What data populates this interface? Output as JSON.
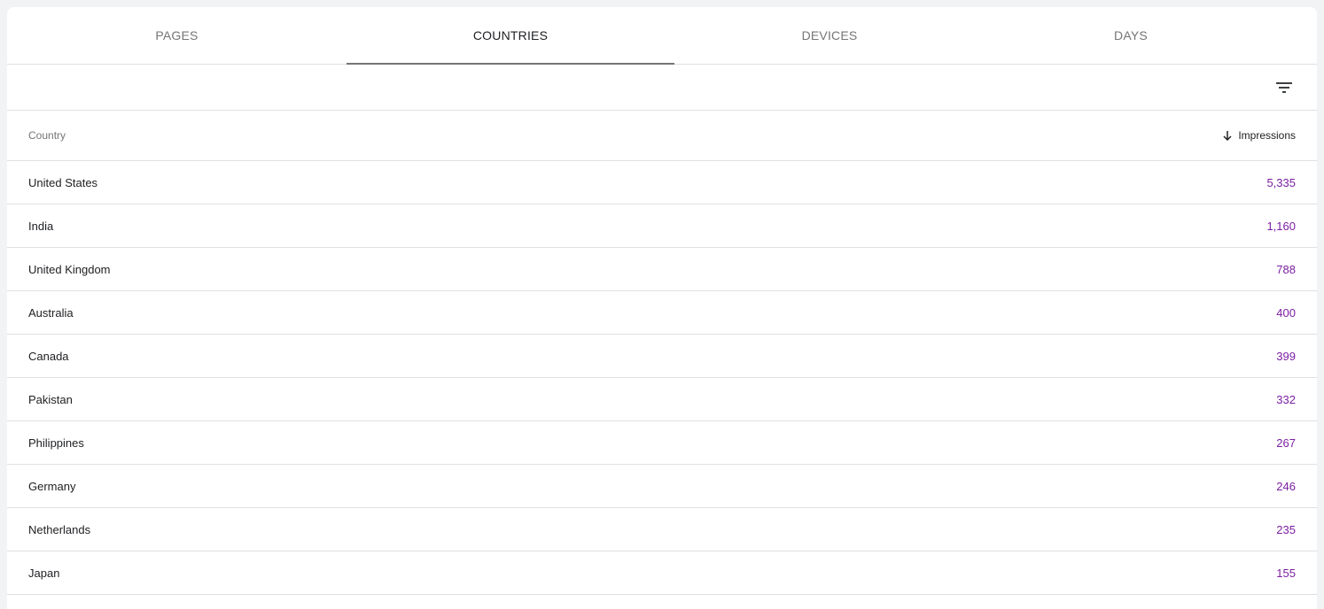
{
  "tabs": [
    {
      "label": "PAGES"
    },
    {
      "label": "COUNTRIES"
    },
    {
      "label": "DEVICES"
    },
    {
      "label": "DAYS"
    }
  ],
  "active_tab": "COUNTRIES",
  "toolbar": {
    "filter_icon": "filter-list-icon"
  },
  "table": {
    "columns": {
      "country": "Country",
      "impressions": "Impressions"
    },
    "sort_icon": "arrow-down-icon",
    "rows": [
      {
        "country": "United States",
        "impressions": "5,335"
      },
      {
        "country": "India",
        "impressions": "1,160"
      },
      {
        "country": "United Kingdom",
        "impressions": "788"
      },
      {
        "country": "Australia",
        "impressions": "400"
      },
      {
        "country": "Canada",
        "impressions": "399"
      },
      {
        "country": "Pakistan",
        "impressions": "332"
      },
      {
        "country": "Philippines",
        "impressions": "267"
      },
      {
        "country": "Germany",
        "impressions": "246"
      },
      {
        "country": "Netherlands",
        "impressions": "235"
      },
      {
        "country": "Japan",
        "impressions": "155"
      }
    ]
  },
  "colors": {
    "value_color": "#7b1fa2",
    "tab_indicator": "#757575"
  }
}
